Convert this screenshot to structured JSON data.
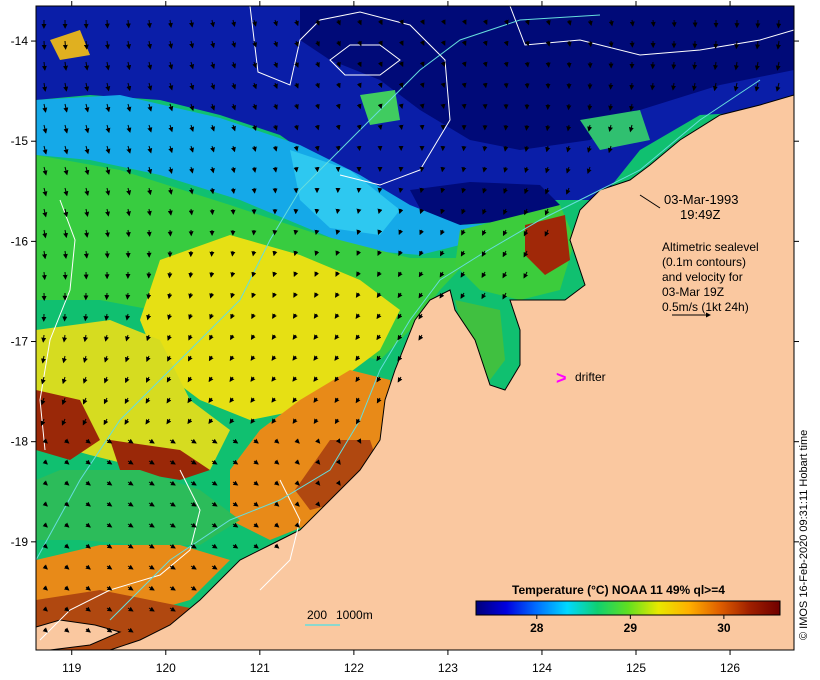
{
  "map": {
    "lat_labels": [
      "-14",
      "-15",
      "-16",
      "-17",
      "-18",
      "-19"
    ],
    "lon_labels": [
      "119",
      "120",
      "121",
      "122",
      "123",
      "124",
      "125",
      "126"
    ],
    "extent": {
      "lon_min": 118.62,
      "lon_max": 126.68,
      "lat_min": -20.08,
      "lat_max": -13.65
    }
  },
  "annotation": {
    "date_line1": "03-Mar-1993",
    "date_line2": "19:49Z",
    "alt_line1": "Altimetric sealevel",
    "alt_line2": "(0.1m contours)",
    "alt_line3": "and velocity for",
    "alt_line4": "03-Mar 19Z",
    "alt_line5": "0.5m/s (1kt 24h)",
    "drifter_symbol": ">",
    "drifter_label": "drifter",
    "depth_200": "200",
    "depth_1000": "1000m"
  },
  "colorbar": {
    "title": "Temperature (°C) NOAA 11 49% ql>=4",
    "tick_labels": [
      "28",
      "29",
      "30"
    ],
    "tick_values": [
      28,
      29,
      30
    ],
    "range": [
      27.35,
      30.6
    ],
    "colors": [
      "#00007a",
      "#0000e0",
      "#0070ff",
      "#00d8ff",
      "#10d070",
      "#60e020",
      "#e8e800",
      "#ffb000",
      "#e06000",
      "#a02000",
      "#700000"
    ]
  },
  "credit": "© IMOS 16-Feb-2020 09:31:11 Hobart time",
  "colors": {
    "land": "#fac8a0",
    "drifter": "#ff00ff",
    "depth_contour": "#66dddd",
    "sealevel_contour": "#ffffff"
  }
}
